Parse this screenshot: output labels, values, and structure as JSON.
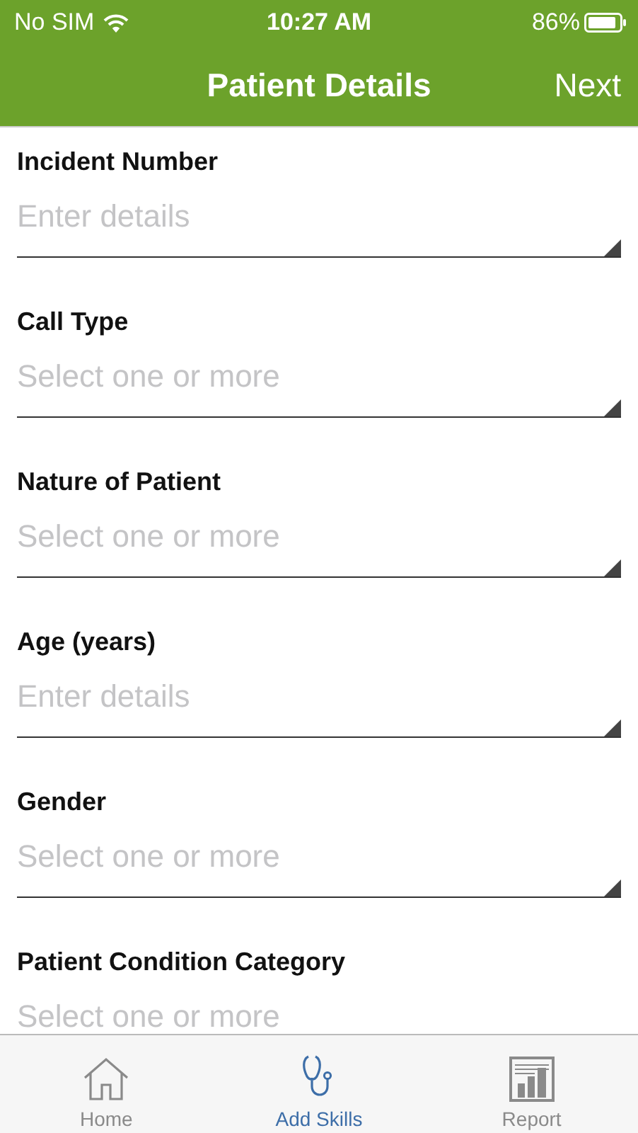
{
  "status_bar": {
    "carrier": "No SIM",
    "time": "10:27 AM",
    "battery": "86%"
  },
  "nav_bar": {
    "title": "Patient Details",
    "action": "Next"
  },
  "fields": [
    {
      "label": "Incident Number",
      "placeholder": "Enter details"
    },
    {
      "label": "Call Type",
      "placeholder": "Select one or more"
    },
    {
      "label": "Nature of Patient",
      "placeholder": "Select one or more"
    },
    {
      "label": "Age (years)",
      "placeholder": "Enter details"
    },
    {
      "label": "Gender",
      "placeholder": "Select one or more"
    },
    {
      "label": "Patient Condition Category",
      "placeholder": "Select one or more"
    }
  ],
  "tab_bar": [
    {
      "label": "Home",
      "kind": "home",
      "selected": false
    },
    {
      "label": "Add Skills",
      "kind": "skills",
      "selected": true
    },
    {
      "label": "Report",
      "kind": "report",
      "selected": false
    }
  ]
}
